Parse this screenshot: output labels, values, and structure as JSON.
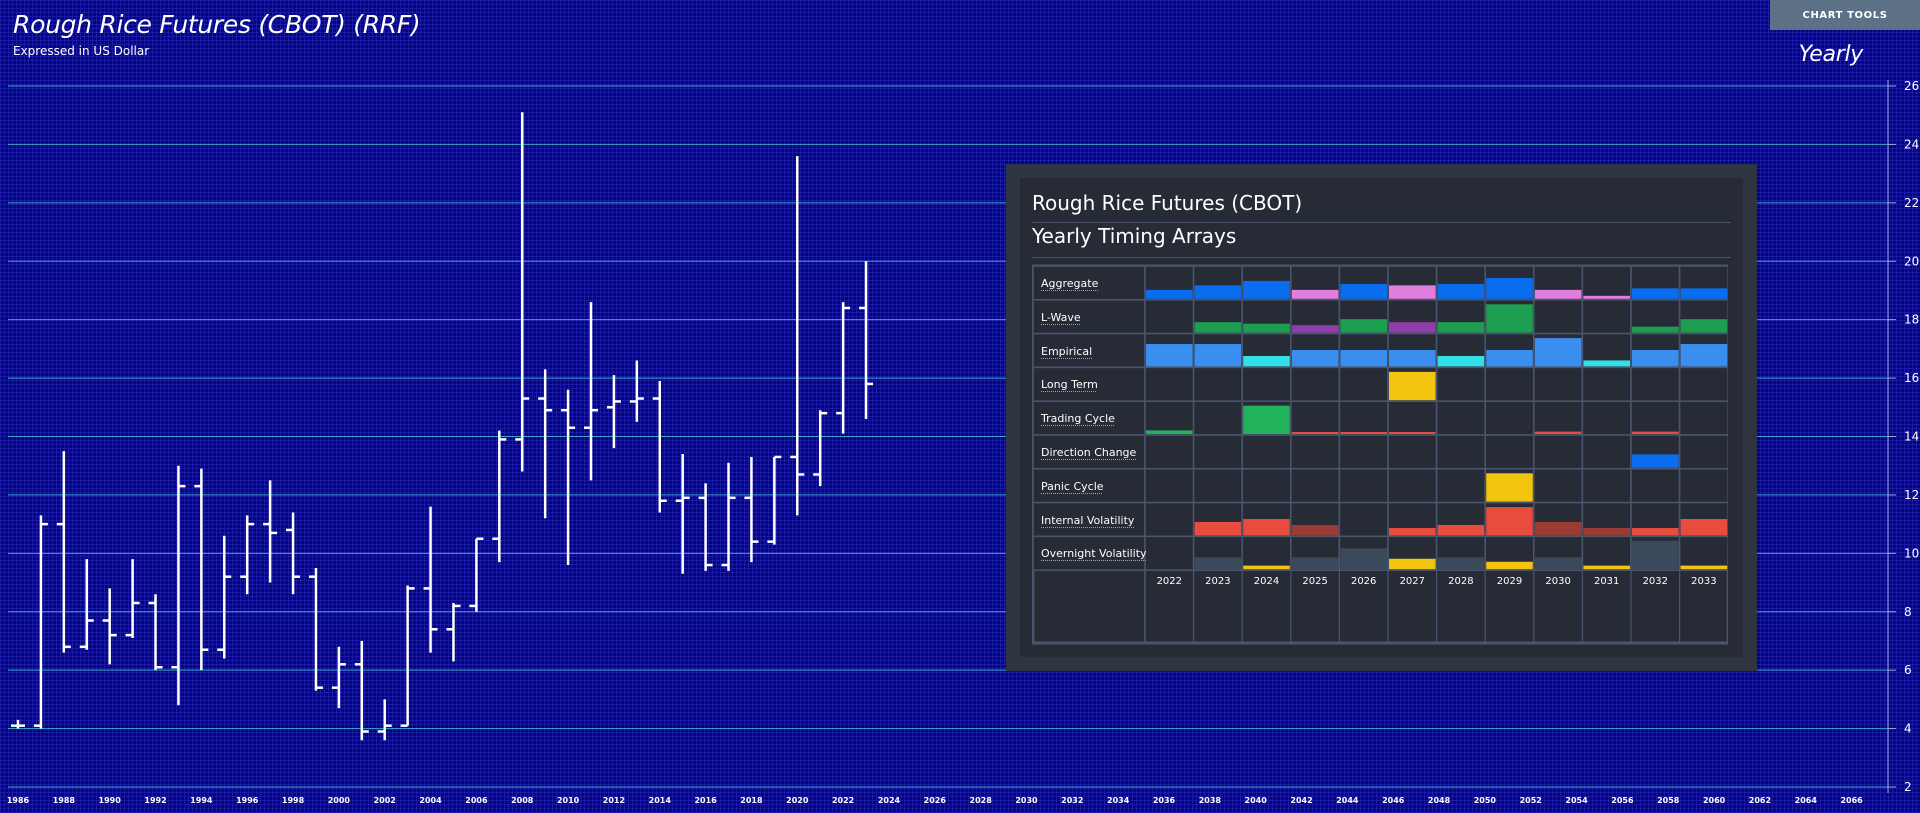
{
  "header": {
    "title": "Rough Rice Futures (CBOT) (RRF)",
    "subtitle": "Expressed in US Dollar",
    "period": "Yearly",
    "tools_label": "CHART TOOLS"
  },
  "colors": {
    "background": "#06067c",
    "gridline": "#3aa5c8",
    "bar": "#ffffff",
    "panel": "#2e3440",
    "cell": "#262b36"
  },
  "chart_data": {
    "type": "ohlc",
    "ylim": [
      2,
      26
    ],
    "y_ticks": [
      2,
      4,
      6,
      8,
      10,
      12,
      14,
      16,
      18,
      20,
      22,
      24,
      26
    ],
    "x_ticks": [
      "1986",
      "1988",
      "1990",
      "1992",
      "1994",
      "1996",
      "1998",
      "2000",
      "2002",
      "2004",
      "2006",
      "2008",
      "2010",
      "2012",
      "2014",
      "2016",
      "2018",
      "2020",
      "2022",
      "2024",
      "2026",
      "2028",
      "2030",
      "2032",
      "2034",
      "2036",
      "2038",
      "2040",
      "2042",
      "2044",
      "2046",
      "2048",
      "2050",
      "2052",
      "2054",
      "2056",
      "2058",
      "2060",
      "2062",
      "2064",
      "2066"
    ],
    "x_range": [
      1986,
      2066
    ],
    "bars": [
      {
        "year": 1986,
        "open": 4.1,
        "high": 4.3,
        "low": 4.0,
        "close": 4.1
      },
      {
        "year": 1987,
        "open": 4.1,
        "high": 11.3,
        "low": 4.0,
        "close": 11.0
      },
      {
        "year": 1988,
        "open": 11.0,
        "high": 13.5,
        "low": 6.6,
        "close": 6.8
      },
      {
        "year": 1989,
        "open": 6.8,
        "high": 9.8,
        "low": 6.7,
        "close": 7.7
      },
      {
        "year": 1990,
        "open": 7.7,
        "high": 8.8,
        "low": 6.2,
        "close": 7.2
      },
      {
        "year": 1991,
        "open": 7.2,
        "high": 9.8,
        "low": 7.1,
        "close": 8.3
      },
      {
        "year": 1992,
        "open": 8.3,
        "high": 8.6,
        "low": 6.0,
        "close": 6.1
      },
      {
        "year": 1993,
        "open": 6.1,
        "high": 13.0,
        "low": 4.8,
        "close": 12.3
      },
      {
        "year": 1994,
        "open": 12.3,
        "high": 12.9,
        "low": 6.0,
        "close": 6.7
      },
      {
        "year": 1995,
        "open": 6.7,
        "high": 10.6,
        "low": 6.4,
        "close": 9.2
      },
      {
        "year": 1996,
        "open": 9.2,
        "high": 11.3,
        "low": 8.6,
        "close": 11.0
      },
      {
        "year": 1997,
        "open": 11.0,
        "high": 12.5,
        "low": 9.0,
        "close": 10.7
      },
      {
        "year": 1998,
        "open": 10.8,
        "high": 11.4,
        "low": 8.6,
        "close": 9.2
      },
      {
        "year": 1999,
        "open": 9.2,
        "high": 9.5,
        "low": 5.3,
        "close": 5.4
      },
      {
        "year": 2000,
        "open": 5.4,
        "high": 6.8,
        "low": 4.7,
        "close": 6.2
      },
      {
        "year": 2001,
        "open": 6.2,
        "high": 7.0,
        "low": 3.6,
        "close": 3.9
      },
      {
        "year": 2002,
        "open": 3.9,
        "high": 5.0,
        "low": 3.6,
        "close": 4.1
      },
      {
        "year": 2003,
        "open": 4.1,
        "high": 8.9,
        "low": 4.1,
        "close": 8.8
      },
      {
        "year": 2004,
        "open": 8.8,
        "high": 11.6,
        "low": 6.6,
        "close": 7.4
      },
      {
        "year": 2005,
        "open": 7.4,
        "high": 8.3,
        "low": 6.3,
        "close": 8.2
      },
      {
        "year": 2006,
        "open": 8.2,
        "high": 10.5,
        "low": 8.0,
        "close": 10.5
      },
      {
        "year": 2007,
        "open": 10.5,
        "high": 14.2,
        "low": 9.7,
        "close": 13.9
      },
      {
        "year": 2008,
        "open": 13.9,
        "high": 25.1,
        "low": 12.8,
        "close": 15.3
      },
      {
        "year": 2009,
        "open": 15.3,
        "high": 16.3,
        "low": 11.2,
        "close": 14.9
      },
      {
        "year": 2010,
        "open": 14.9,
        "high": 15.6,
        "low": 9.6,
        "close": 14.3
      },
      {
        "year": 2011,
        "open": 14.3,
        "high": 18.6,
        "low": 12.5,
        "close": 14.9
      },
      {
        "year": 2012,
        "open": 15.0,
        "high": 16.1,
        "low": 13.6,
        "close": 15.2
      },
      {
        "year": 2013,
        "open": 15.2,
        "high": 16.6,
        "low": 14.5,
        "close": 15.3
      },
      {
        "year": 2014,
        "open": 15.3,
        "high": 15.9,
        "low": 11.4,
        "close": 11.8
      },
      {
        "year": 2015,
        "open": 11.8,
        "high": 13.4,
        "low": 9.3,
        "close": 11.9
      },
      {
        "year": 2016,
        "open": 11.9,
        "high": 12.4,
        "low": 9.4,
        "close": 9.6
      },
      {
        "year": 2017,
        "open": 9.6,
        "high": 13.1,
        "low": 9.4,
        "close": 11.9
      },
      {
        "year": 2018,
        "open": 11.9,
        "high": 13.3,
        "low": 9.7,
        "close": 10.4
      },
      {
        "year": 2019,
        "open": 10.4,
        "high": 13.3,
        "low": 10.3,
        "close": 13.3
      },
      {
        "year": 2020,
        "open": 13.3,
        "high": 23.6,
        "low": 11.3,
        "close": 12.7
      },
      {
        "year": 2021,
        "open": 12.7,
        "high": 14.9,
        "low": 12.3,
        "close": 14.8
      },
      {
        "year": 2022,
        "open": 14.8,
        "high": 18.6,
        "low": 14.1,
        "close": 18.4
      },
      {
        "year": 2023,
        "open": 18.4,
        "high": 20.0,
        "low": 14.6,
        "close": 15.8
      }
    ]
  },
  "panel": {
    "title": "Rough Rice Futures (CBOT)",
    "subtitle": "Yearly Timing Arrays",
    "years": [
      "2022",
      "2023",
      "2024",
      "2025",
      "2026",
      "2027",
      "2028",
      "2029",
      "2030",
      "2031",
      "2032",
      "2033"
    ],
    "rows": [
      {
        "label": "Aggregate",
        "values": [
          0.3,
          0.45,
          0.6,
          0.3,
          0.5,
          0.45,
          0.5,
          0.7,
          0.3,
          0.1,
          0.35,
          0.35
        ],
        "colors": [
          "#0a6df0",
          "#0a6df0",
          "#0a6df0",
          "#e07ee0",
          "#0a6df0",
          "#e07ee0",
          "#0a6df0",
          "#0a6df0",
          "#e07ee0",
          "#e07ee0",
          "#0a6df0",
          "#0a6df0"
        ]
      },
      {
        "label": "L-Wave",
        "values": [
          0,
          0.35,
          0.3,
          0.25,
          0.45,
          0.35,
          0.35,
          0.95,
          0,
          0,
          0.2,
          0.45
        ],
        "colors": [
          "#1e9e50",
          "#1e9e50",
          "#1e9e50",
          "#8e3ea8",
          "#1e9e50",
          "#8e3ea8",
          "#1e9e50",
          "#1e9e50",
          "#1e9e50",
          "#1e9e50",
          "#1e9e50",
          "#1e9e50"
        ]
      },
      {
        "label": "Empirical",
        "values": [
          0.75,
          0.75,
          0.35,
          0.55,
          0.55,
          0.55,
          0.35,
          0.55,
          0.95,
          0.2,
          0.55,
          0.75
        ],
        "colors": [
          "#3a8ef0",
          "#3a8ef0",
          "#34e0e8",
          "#3a8ef0",
          "#3a8ef0",
          "#3a8ef0",
          "#34e0e8",
          "#3a8ef0",
          "#3a8ef0",
          "#34e0e8",
          "#3a8ef0",
          "#3a8ef0"
        ]
      },
      {
        "label": "Long Term",
        "values": [
          0,
          0,
          0,
          0,
          0,
          0.95,
          0,
          0,
          0,
          0,
          0,
          0
        ],
        "colors": [
          "#f2c40f",
          "#f2c40f",
          "#f2c40f",
          "#f2c40f",
          "#f2c40f",
          "#f2c40f",
          "#f2c40f",
          "#f2c40f",
          "#f2c40f",
          "#f2c40f",
          "#f2c40f",
          "#f2c40f"
        ]
      },
      {
        "label": "Trading Cycle",
        "values": [
          0.12,
          0,
          0.95,
          0.05,
          0.05,
          0.05,
          0,
          0,
          0.08,
          0,
          0.08,
          0
        ],
        "colors": [
          "#22b35a",
          "#22b35a",
          "#22b35a",
          "#e74c3c",
          "#e74c3c",
          "#e74c3c",
          "#e74c3c",
          "#e74c3c",
          "#e74c3c",
          "#e74c3c",
          "#e74c3c",
          "#e74c3c"
        ]
      },
      {
        "label": "Direction Change",
        "values": [
          0,
          0,
          0,
          0,
          0,
          0,
          0,
          0,
          0,
          0,
          0.45,
          0
        ],
        "colors": [
          "#0a6df0",
          "#0a6df0",
          "#0a6df0",
          "#0a6df0",
          "#0a6df0",
          "#0a6df0",
          "#0a6df0",
          "#0a6df0",
          "#0a6df0",
          "#0a6df0",
          "#0a6df0",
          "#0a6df0"
        ]
      },
      {
        "label": "Panic Cycle",
        "values": [
          0,
          0,
          0,
          0,
          0,
          0,
          0,
          0.95,
          0,
          0,
          0,
          0
        ],
        "colors": [
          "#f2c40f",
          "#f2c40f",
          "#f2c40f",
          "#f2c40f",
          "#f2c40f",
          "#f2c40f",
          "#f2c40f",
          "#f2c40f",
          "#f2c40f",
          "#f2c40f",
          "#f2c40f",
          "#f2c40f"
        ]
      },
      {
        "label": "Internal Volatility",
        "values": [
          0,
          0.45,
          0.55,
          0.35,
          0,
          0.25,
          0.35,
          0.95,
          0.45,
          0.25,
          0.25,
          0.55
        ],
        "colors": [
          "#e74c3c",
          "#e74c3c",
          "#e74c3c",
          "#9b3b34",
          "#e74c3c",
          "#e74c3c",
          "#e74c3c",
          "#e74c3c",
          "#9b3b34",
          "#9b3b34",
          "#e74c3c",
          "#e74c3c"
        ]
      },
      {
        "label": "Overnight Volatility",
        "values": [
          0,
          0.4,
          0.12,
          0.4,
          0.7,
          0.35,
          0.4,
          0.25,
          0.4,
          0.12,
          0.95,
          0.12
        ],
        "colors": [
          "#3a4a5a",
          "#3a4a5a",
          "#f2c40f",
          "#3a4a5a",
          "#3a4a5a",
          "#f2c40f",
          "#3a4a5a",
          "#f2c40f",
          "#3a4a5a",
          "#f2c40f",
          "#3a4a5a",
          "#f2c40f"
        ]
      }
    ]
  }
}
